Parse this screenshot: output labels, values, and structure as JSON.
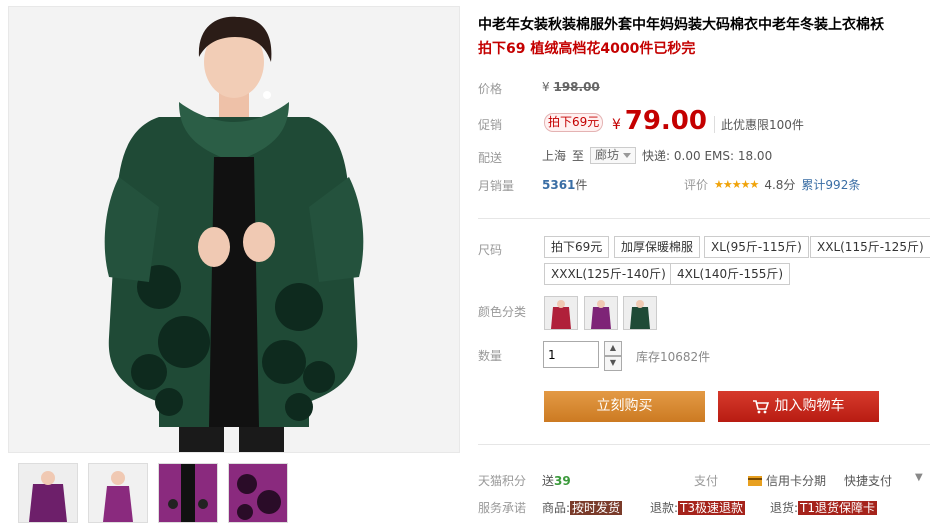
{
  "product": {
    "title": "中老年女装秋装棉服外套中年妈妈装大码棉衣中老年冬装上衣棉袄",
    "subtitle": "拍下69 植绒高档花4000件已秒完"
  },
  "price": {
    "label": "价格",
    "currency": "¥",
    "original": "198.00"
  },
  "promo": {
    "label": "促销",
    "tag": "拍下69元",
    "currency": "¥",
    "price": "79.00",
    "limit_text": "此优惠限100件"
  },
  "shipping": {
    "label": "配送",
    "from": "上海",
    "to_word": "至",
    "destination": "廊坊",
    "fee": "快递: 0.00 EMS: 18.00"
  },
  "sales": {
    "label": "月销量",
    "count": "5361",
    "unit": "件",
    "rating_label": "评价",
    "stars": "★★★★★",
    "score": "4.8分",
    "cumulative": "累计992条"
  },
  "size": {
    "label": "尺码",
    "options": [
      "拍下69元",
      "加厚保暖棉服",
      "XL(95斤-115斤)",
      "XXL(115斤-125斤)",
      "XXXL(125斤-140斤)",
      "4XL(140斤-155斤)"
    ]
  },
  "color": {
    "label": "颜色分类",
    "swatches": [
      "red",
      "purple",
      "green"
    ]
  },
  "quantity": {
    "label": "数量",
    "value": "1",
    "stock": "库存10682件"
  },
  "buttons": {
    "buy": "立刻购买",
    "cart": "加入购物车"
  },
  "footer": {
    "points_label": "天猫积分",
    "points_prefix": "送",
    "points_value": "39",
    "pay_label": "支付",
    "credit": "信用卡分期",
    "quick_pay": "快捷支付",
    "service_label": "服务承诺",
    "goods_label": "商品:",
    "goods_tag": "按时发货",
    "refund_label": "退款:",
    "refund_tag": "T3极速退款",
    "return_label": "退货:",
    "return_tag": "T1退货保障卡"
  },
  "colors": {
    "price_red": "#c40000",
    "buy_orange": "#d9862e",
    "cart_red": "#c8261a",
    "link_blue": "#3a6ea5",
    "jacket_green": "#1f4a36"
  }
}
